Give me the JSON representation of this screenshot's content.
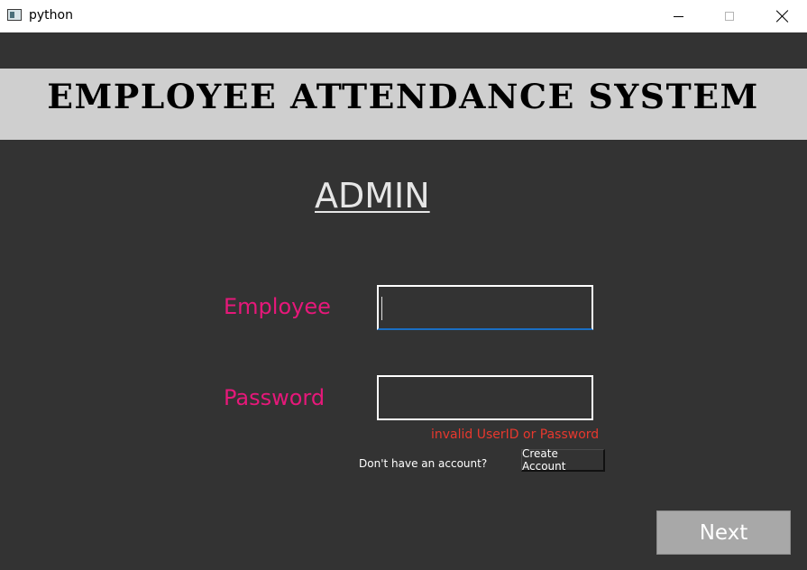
{
  "window": {
    "title": "python",
    "minimize_icon": "minimize-icon",
    "maximize_icon": "maximize-icon",
    "close_icon": "close-icon"
  },
  "banner": {
    "title": "EMPLOYEE ATTENDANCE SYSTEM"
  },
  "heading": "ADMIN",
  "form": {
    "employee_label": "Employee",
    "employee_value": "",
    "password_label": "Password",
    "password_value": "",
    "error_message": "invalid UserID or Password",
    "no_account_text": "Don't have an account?",
    "create_account_label": "Create Account",
    "next_label": "Next"
  },
  "colors": {
    "background": "#333333",
    "banner": "#cfcfcf",
    "label": "#e6187a",
    "error": "#e8382e",
    "focus_underline": "#1a6fc4",
    "next_button": "#a8a8a8"
  }
}
